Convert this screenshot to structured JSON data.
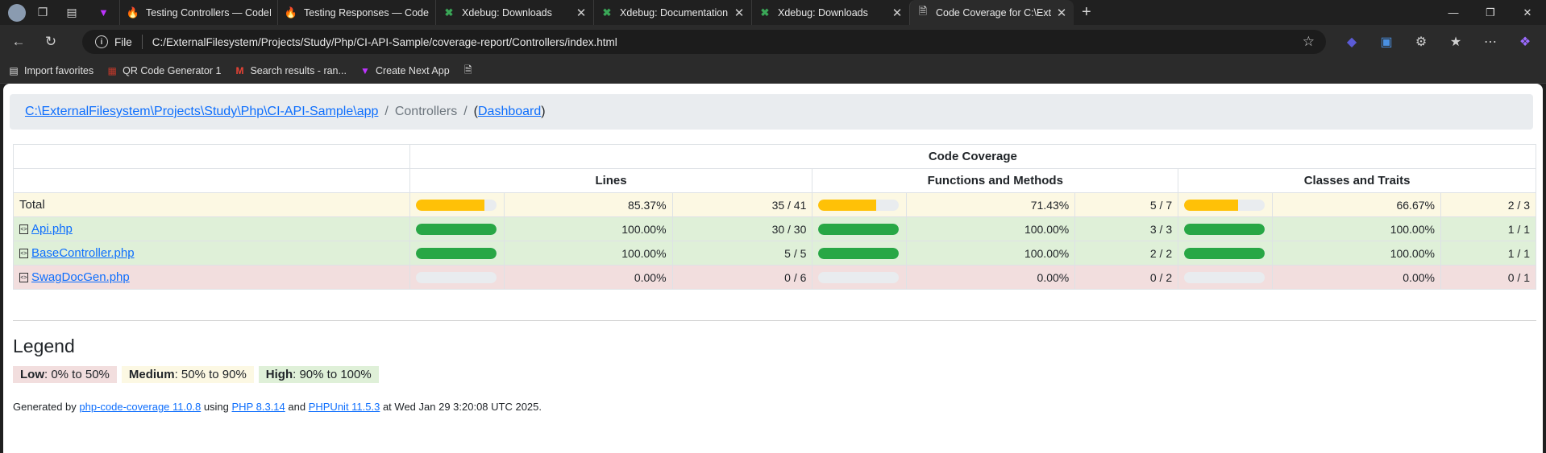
{
  "browser": {
    "tabs": [
      {
        "title": "Testing Controllers — CodeIgnite",
        "icon": "codeigniter-icon"
      },
      {
        "title": "Testing Responses — CodeIgniter",
        "icon": "codeigniter-icon"
      },
      {
        "title": "Xdebug: Downloads",
        "icon": "xdebug-icon"
      },
      {
        "title": "Xdebug: Documentation » Installa",
        "icon": "xdebug-icon"
      },
      {
        "title": "Xdebug: Downloads",
        "icon": "xdebug-icon"
      },
      {
        "title": "Code Coverage for C:\\ExternalFile",
        "icon": "page-icon",
        "active": true
      }
    ],
    "address": {
      "scheme_label": "File",
      "url": "C:/ExternalFilesystem/Projects/Study/Php/CI-API-Sample/coverage-report/Controllers/index.html"
    },
    "bookmarks": [
      {
        "label": "Import favorites",
        "icon": "import-icon"
      },
      {
        "label": "QR Code Generator 1",
        "icon": "qr-icon"
      },
      {
        "label": "Search results - ran...",
        "icon": "gmail-icon"
      },
      {
        "label": "Create Next App",
        "icon": "vite-icon"
      },
      {
        "label": "",
        "icon": "page-icon"
      }
    ]
  },
  "report": {
    "breadcrumb": {
      "root": "C:\\ExternalFilesystem\\Projects\\Study\\Php\\CI-API-Sample\\app",
      "separator": "/",
      "current": "Controllers",
      "dashboard_open": "(",
      "dashboard": "Dashboard",
      "dashboard_close": ")"
    },
    "table": {
      "group_header": "Code Coverage",
      "columns": [
        "Lines",
        "Functions and Methods",
        "Classes and Traits"
      ],
      "rows": [
        {
          "name": "Total",
          "level": "total",
          "link": false,
          "lines": {
            "fraction": 0.8537,
            "pct": "85.37%",
            "ratio": "35 / 41"
          },
          "functions": {
            "fraction": 0.7143,
            "pct": "71.43%",
            "ratio": "5 / 7"
          },
          "classes": {
            "fraction": 0.6667,
            "pct": "66.67%",
            "ratio": "2 / 3"
          }
        },
        {
          "name": "Api.php",
          "level": "high",
          "link": true,
          "lines": {
            "fraction": 1.0,
            "pct": "100.00%",
            "ratio": "30 / 30"
          },
          "functions": {
            "fraction": 1.0,
            "pct": "100.00%",
            "ratio": "3 / 3"
          },
          "classes": {
            "fraction": 1.0,
            "pct": "100.00%",
            "ratio": "1 / 1"
          }
        },
        {
          "name": "BaseController.php",
          "level": "high",
          "link": true,
          "lines": {
            "fraction": 1.0,
            "pct": "100.00%",
            "ratio": "5 / 5"
          },
          "functions": {
            "fraction": 1.0,
            "pct": "100.00%",
            "ratio": "2 / 2"
          },
          "classes": {
            "fraction": 1.0,
            "pct": "100.00%",
            "ratio": "1 / 1"
          }
        },
        {
          "name": "SwagDocGen.php",
          "level": "low",
          "link": true,
          "lines": {
            "fraction": 0.0,
            "pct": "0.00%",
            "ratio": "0 / 6"
          },
          "functions": {
            "fraction": 0.0,
            "pct": "0.00%",
            "ratio": "0 / 2"
          },
          "classes": {
            "fraction": 0.0,
            "pct": "0.00%",
            "ratio": "0 / 1"
          }
        }
      ]
    },
    "legend": {
      "title": "Legend",
      "low_label": "Low",
      "low_range": ": 0% to 50%",
      "medium_label": "Medium",
      "medium_range": ": 50% to 90%",
      "high_label": "High",
      "high_range": ": 90% to 100%"
    },
    "footer": {
      "generated_by": "Generated by ",
      "tool_link": "php-code-coverage 11.0.8",
      "using": " using ",
      "php_link": "PHP 8.3.14",
      "and": " and ",
      "phpunit_link": "PHPUnit 11.5.3",
      "at": " at Wed Jan 29 3:20:08 UTC 2025."
    }
  },
  "colors": {
    "low": "#f2dede",
    "medium": "#fcf8e3",
    "high": "#dff0d8",
    "bar_warning": "#ffc107",
    "bar_success": "#28a745",
    "link": "#0d6efd"
  }
}
